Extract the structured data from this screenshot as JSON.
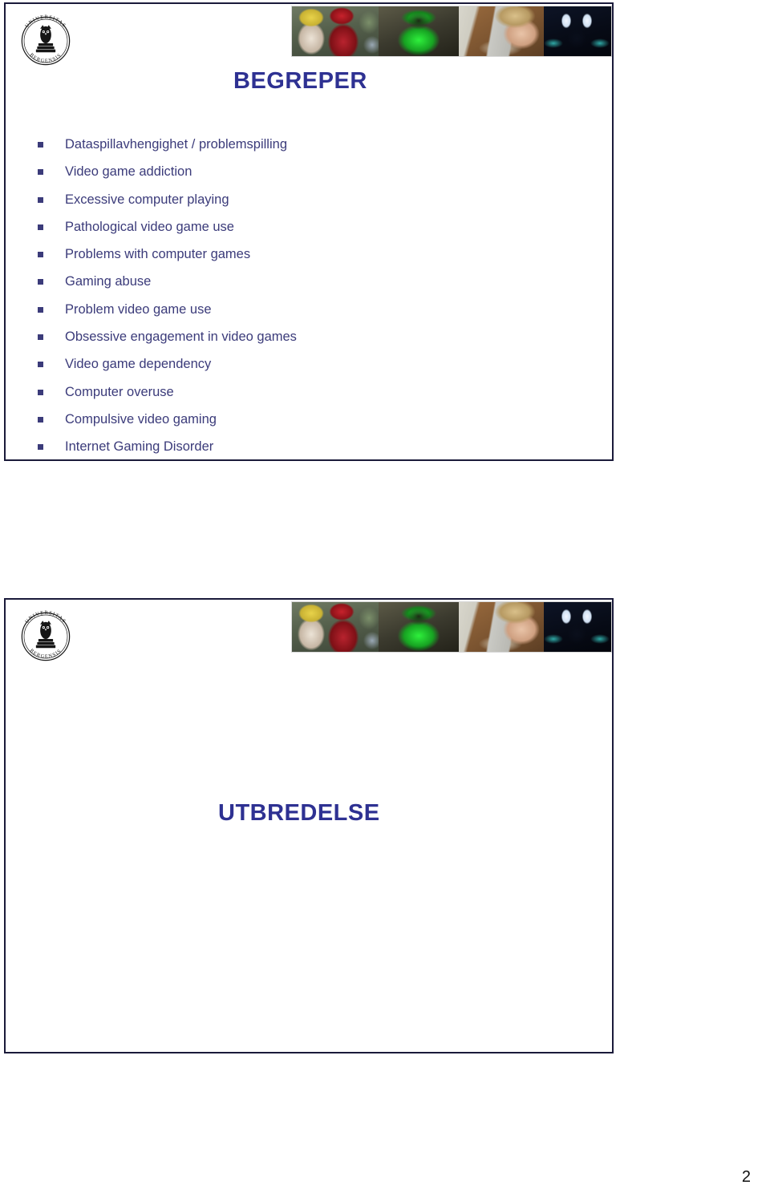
{
  "page": {
    "page_number": "2",
    "accent_color": "#2e3192",
    "body_text_color": "#3b3b7a",
    "border_color": "#1a1a3a"
  },
  "logo": {
    "name": "university-of-bergen-seal",
    "outer_text_top": "UNIVERSITAS",
    "outer_text_bottom": "BERGENSIS",
    "emblem": "owl-on-book"
  },
  "photo_strip": {
    "photos": [
      {
        "name": "kids-playing-handheld-games",
        "alt": "Two children wearing yellow and red caps playing handheld game consoles outdoors"
      },
      {
        "name": "green-lit-gamer-with-controller",
        "alt": "Person lit by green screen glow holding a game controller"
      },
      {
        "name": "person-asleep-on-keyboard",
        "alt": "Young man asleep with face resting on a computer keyboard"
      },
      {
        "name": "silhouette-at-monitors",
        "alt": "Dark silhouette of a person in front of two bright glowing monitors"
      }
    ]
  },
  "slide1": {
    "title": "BEGREPER",
    "bullets": [
      "Dataspillavhengighet / problemspilling",
      "Video game addiction",
      "Excessive computer playing",
      "Pathological video game use",
      "Problems with computer games",
      "Gaming abuse",
      "Problem video game use",
      "Obsessive engagement in video games",
      "Video game dependency",
      "Computer overuse",
      "Compulsive video gaming",
      "Internet Gaming Disorder"
    ]
  },
  "slide2": {
    "title": "UTBREDELSE",
    "bullets": []
  }
}
